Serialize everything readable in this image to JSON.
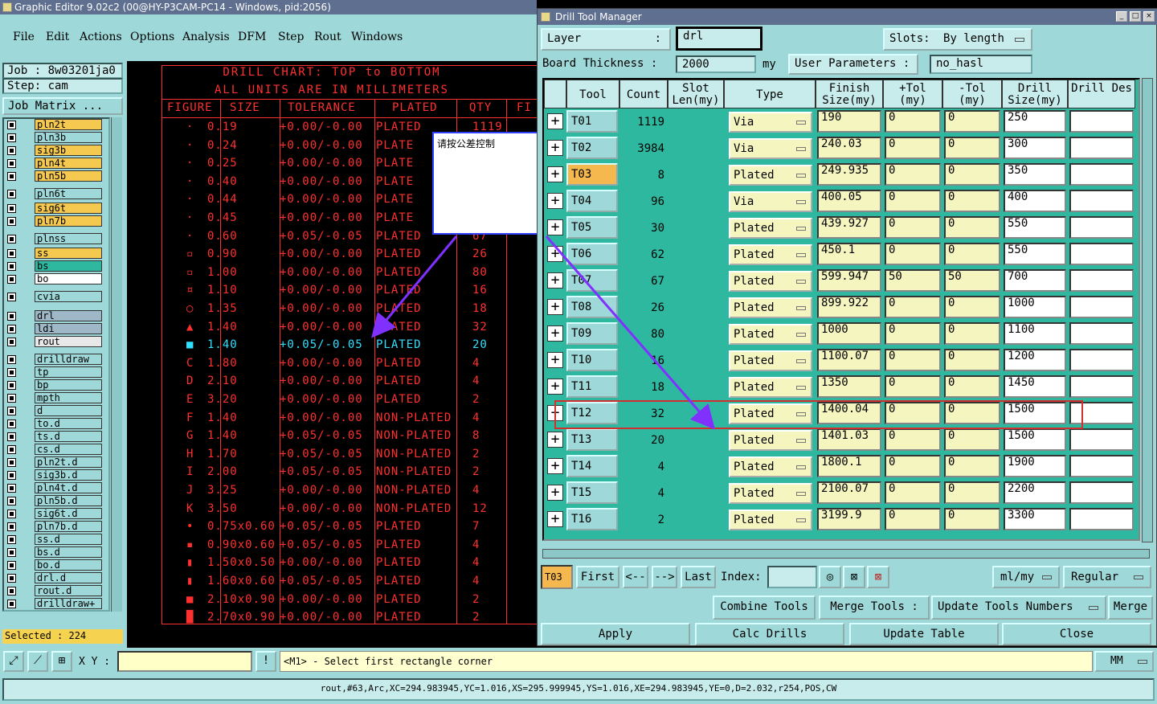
{
  "app": {
    "title": "Graphic Editor 9.02c2 (00@HY-P3CAM-PC14 - Windows, pid:2056)"
  },
  "menu": [
    "File",
    "Edit",
    "Actions",
    "Options",
    "Analysis",
    "DFM",
    "Step",
    "Rout",
    "Windows"
  ],
  "left_panel": {
    "job": "Job : 8w03201ja0",
    "step": "Step: cam",
    "job_matrix": "Job Matrix ...",
    "selected": "Selected : 224",
    "layers": [
      {
        "name": "pln2t",
        "color": "#f5c84f"
      },
      {
        "name": "pln3b",
        "color": "#9fd8d8"
      },
      {
        "name": "sig3b",
        "color": "#f5c84f"
      },
      {
        "name": "pln4t",
        "color": "#f5c84f"
      },
      {
        "name": "pln5b",
        "color": "#f5c84f"
      },
      {
        "name": "pln6t",
        "color": "#9fd8d8"
      },
      {
        "name": "sig6t",
        "color": "#f5c84f"
      },
      {
        "name": "pln7b",
        "color": "#f5c84f"
      },
      {
        "name": "plnss",
        "color": "#9fd8d8"
      },
      {
        "name": "ss",
        "color": "#f5c84f"
      },
      {
        "name": "bs",
        "color": "#2fb8a0"
      },
      {
        "name": "bo",
        "color": "#ffffff"
      },
      {
        "name": "cvia",
        "color": "#9fd8d8"
      },
      {
        "name": "drl",
        "color": "#9fb8c8"
      },
      {
        "name": "ldi",
        "color": "#9fb8c8"
      },
      {
        "name": "rout",
        "color": "#e8e8e8"
      },
      {
        "name": "drilldraw",
        "color": "#9fd8d8"
      },
      {
        "name": "tp",
        "color": "#9fd8d8"
      },
      {
        "name": "bp",
        "color": "#9fd8d8"
      },
      {
        "name": "mpth",
        "color": "#9fd8d8"
      },
      {
        "name": "d",
        "color": "#9fd8d8"
      },
      {
        "name": "to.d",
        "color": "#9fd8d8"
      },
      {
        "name": "ts.d",
        "color": "#9fd8d8"
      },
      {
        "name": "cs.d",
        "color": "#9fd8d8"
      },
      {
        "name": "pln2t.d",
        "color": "#9fd8d8"
      },
      {
        "name": "sig3b.d",
        "color": "#9fd8d8"
      },
      {
        "name": "pln4t.d",
        "color": "#9fd8d8"
      },
      {
        "name": "pln5b.d",
        "color": "#9fd8d8"
      },
      {
        "name": "sig6t.d",
        "color": "#9fd8d8"
      },
      {
        "name": "pln7b.d",
        "color": "#9fd8d8"
      },
      {
        "name": "ss.d",
        "color": "#9fd8d8"
      },
      {
        "name": "bs.d",
        "color": "#9fd8d8"
      },
      {
        "name": "bo.d",
        "color": "#9fd8d8"
      },
      {
        "name": "drl.d",
        "color": "#9fd8d8"
      },
      {
        "name": "rout.d",
        "color": "#9fd8d8"
      },
      {
        "name": "drilldraw+",
        "color": "#9fd8d8"
      }
    ]
  },
  "drill_chart": {
    "title1": "DRILL CHART: TOP to BOTTOM",
    "title2": "ALL UNITS ARE IN MILLIMETERS",
    "headers": [
      "FIGURE",
      "SIZE",
      "TOLERANCE",
      "PLATED",
      "QTY",
      "FI"
    ],
    "rows": [
      [
        "·",
        "0.19",
        "+0.00/-0.00",
        "PLATED",
        "1119"
      ],
      [
        "·",
        "0.24",
        "+0.00/-0.00",
        "PLATE",
        ""
      ],
      [
        "·",
        "0.25",
        "+0.00/-0.00",
        "PLATE",
        ""
      ],
      [
        "·",
        "0.40",
        "+0.00/-0.00",
        "PLATE",
        ""
      ],
      [
        "·",
        "0.44",
        "+0.00/-0.00",
        "PLATE",
        ""
      ],
      [
        "·",
        "0.45",
        "+0.00/-0.00",
        "PLATE",
        ""
      ],
      [
        "·",
        "0.60",
        "+0.05/-0.05",
        "PLATED",
        "67"
      ],
      [
        "▫",
        "0.90",
        "+0.00/-0.00",
        "PLATED",
        "26"
      ],
      [
        "▫",
        "1.00",
        "+0.00/-0.00",
        "PLATED",
        "80"
      ],
      [
        "¤",
        "1.10",
        "+0.00/-0.00",
        "PLATED",
        "16"
      ],
      [
        "○",
        "1.35",
        "+0.00/-0.00",
        "PLATED",
        "18"
      ],
      [
        "▲",
        "1.40",
        "+0.00/-0.00",
        "PLATED",
        "32"
      ],
      [
        "■",
        "1.40",
        "+0.05/-0.05",
        "PLATED",
        "20"
      ],
      [
        "C",
        "1.80",
        "+0.00/-0.00",
        "PLATED",
        "4"
      ],
      [
        "D",
        "2.10",
        "+0.00/-0.00",
        "PLATED",
        "4"
      ],
      [
        "E",
        "3.20",
        "+0.00/-0.00",
        "PLATED",
        "2"
      ],
      [
        "F",
        "1.40",
        "+0.00/-0.00",
        "NON-PLATED",
        "4"
      ],
      [
        "G",
        "1.40",
        "+0.05/-0.05",
        "NON-PLATED",
        "8"
      ],
      [
        "H",
        "1.70",
        "+0.05/-0.05",
        "NON-PLATED",
        "2"
      ],
      [
        "I",
        "2.00",
        "+0.05/-0.05",
        "NON-PLATED",
        "2"
      ],
      [
        "J",
        "3.25",
        "+0.00/-0.00",
        "NON-PLATED",
        "4"
      ],
      [
        "K",
        "3.50",
        "+0.00/-0.00",
        "NON-PLATED",
        "12"
      ],
      [
        "•",
        "0.75x0.60",
        "+0.05/-0.05",
        "PLATED",
        "7"
      ],
      [
        "▪",
        "0.90x0.60",
        "+0.05/-0.05",
        "PLATED",
        "4"
      ],
      [
        "▮",
        "1.50x0.50",
        "+0.00/-0.00",
        "PLATED",
        "4"
      ],
      [
        "▮",
        "1.60x0.60",
        "+0.05/-0.05",
        "PLATED",
        "4"
      ],
      [
        "■",
        "2.10x0.90",
        "+0.00/-0.00",
        "PLATED",
        "2"
      ],
      [
        "█",
        "2.70x0.90",
        "+0.00/-0.00",
        "PLATED",
        "2"
      ]
    ],
    "highlight_row": 12
  },
  "popup": {
    "text": "请按公差控制"
  },
  "bottom": {
    "xy_label": "X Y :",
    "prompt": "<M1> - Select first rectangle corner",
    "units": "MM",
    "status": "rout,#63,Arc,XC=294.983945,YC=1.016,XS=295.999945,YS=1.016,XE=294.983945,YE=0,D=2.032,r254,POS,CW"
  },
  "dialog": {
    "title": "Drill Tool Manager",
    "layer_label": "Layer",
    "layer_value": "drl",
    "slots_label": "Slots:",
    "slots_value": "By length",
    "board_thickness_label": "Board Thickness :",
    "board_thickness_value": "2000",
    "board_thickness_unit": "my",
    "user_params_label": "User Parameters :",
    "user_params_value": "no_hasl",
    "columns": [
      "Tool",
      "Count",
      "Slot Len(my)",
      "Type",
      "Finish Size(my)",
      "+Tol (my)",
      "-Tol (my)",
      "Drill Size(my)",
      "Drill Des"
    ],
    "tools": [
      {
        "tool": "T01",
        "count": "1119",
        "type": "Via",
        "finish": "190",
        "ptol": "0",
        "mtol": "0",
        "drill": "250"
      },
      {
        "tool": "T02",
        "count": "3984",
        "type": "Via",
        "finish": "240.03",
        "ptol": "0",
        "mtol": "0",
        "drill": "300"
      },
      {
        "tool": "T03",
        "count": "8",
        "type": "Plated",
        "finish": "249.935",
        "ptol": "0",
        "mtol": "0",
        "drill": "350"
      },
      {
        "tool": "T04",
        "count": "96",
        "type": "Via",
        "finish": "400.05",
        "ptol": "0",
        "mtol": "0",
        "drill": "400"
      },
      {
        "tool": "T05",
        "count": "30",
        "type": "Plated",
        "finish": "439.927",
        "ptol": "0",
        "mtol": "0",
        "drill": "550"
      },
      {
        "tool": "T06",
        "count": "62",
        "type": "Plated",
        "finish": "450.1",
        "ptol": "0",
        "mtol": "0",
        "drill": "550"
      },
      {
        "tool": "T07",
        "count": "67",
        "type": "Plated",
        "finish": "599.947",
        "ptol": "50",
        "mtol": "50",
        "drill": "700"
      },
      {
        "tool": "T08",
        "count": "26",
        "type": "Plated",
        "finish": "899.922",
        "ptol": "0",
        "mtol": "0",
        "drill": "1000"
      },
      {
        "tool": "T09",
        "count": "80",
        "type": "Plated",
        "finish": "1000",
        "ptol": "0",
        "mtol": "0",
        "drill": "1100"
      },
      {
        "tool": "T10",
        "count": "16",
        "type": "Plated",
        "finish": "1100.07",
        "ptol": "0",
        "mtol": "0",
        "drill": "1200"
      },
      {
        "tool": "T11",
        "count": "18",
        "type": "Plated",
        "finish": "1350",
        "ptol": "0",
        "mtol": "0",
        "drill": "1450"
      },
      {
        "tool": "T12",
        "count": "32",
        "type": "Plated",
        "finish": "1400.04",
        "ptol": "0",
        "mtol": "0",
        "drill": "1500"
      },
      {
        "tool": "T13",
        "count": "20",
        "type": "Plated",
        "finish": "1401.03",
        "ptol": "0",
        "mtol": "0",
        "drill": "1500"
      },
      {
        "tool": "T14",
        "count": "4",
        "type": "Plated",
        "finish": "1800.1",
        "ptol": "0",
        "mtol": "0",
        "drill": "1900"
      },
      {
        "tool": "T15",
        "count": "4",
        "type": "Plated",
        "finish": "2100.07",
        "ptol": "0",
        "mtol": "0",
        "drill": "2200"
      },
      {
        "tool": "T16",
        "count": "2",
        "type": "Plated",
        "finish": "3199.9",
        "ptol": "0",
        "mtol": "0",
        "drill": "3300"
      }
    ],
    "selected_tool": "T03",
    "nav": {
      "current": "T03",
      "first": "First",
      "prev": "<--",
      "next": "-->",
      "last": "Last",
      "index_label": "Index:",
      "units": "ml/my",
      "mode": "Regular"
    },
    "actions1": {
      "combine": "Combine Tools",
      "merge_tools": "Merge Tools :",
      "update_numbers": "Update Tools Numbers",
      "merge": "Merge"
    },
    "actions2": {
      "apply": "Apply",
      "calc": "Calc Drills",
      "update": "Update Table",
      "close": "Close"
    }
  }
}
